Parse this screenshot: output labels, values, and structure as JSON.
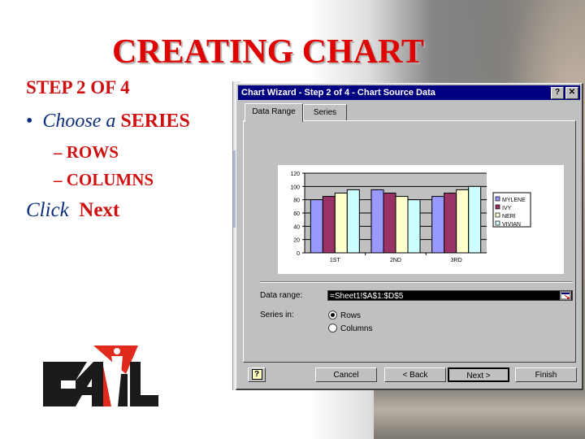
{
  "slide": {
    "title": "CREATING CHART",
    "step": "STEP 2 OF 4",
    "bullet": {
      "marker": "•",
      "prefix": "Choose a ",
      "emphasis": "SERIES"
    },
    "subitems": [
      "– ROWS",
      "– COLUMNS"
    ],
    "instruction": {
      "prefix": "Click",
      "action": "Next"
    },
    "logo_text": "CAIL",
    "colors": {
      "title": "#e00000",
      "body_blue": "#0c2f7c",
      "body_red": "#d01010"
    }
  },
  "dialog": {
    "title": "Chart Wizard - Step 2 of 4 - Chart Source Data",
    "help_glyph": "?",
    "close_glyph": "✕",
    "tabs": [
      {
        "label": "Data Range",
        "active": true
      },
      {
        "label": "Series",
        "active": false
      }
    ],
    "data_range_label": "Data range:",
    "data_range_value": "=Sheet1!$A$1:$D$5",
    "series_in_label": "Series in:",
    "series_options": [
      {
        "label": "Rows",
        "selected": true
      },
      {
        "label": "Columns",
        "selected": false
      }
    ],
    "buttons": {
      "help": "?",
      "cancel": "Cancel",
      "back": "< Back",
      "next": "Next >",
      "finish": "Finish"
    }
  },
  "chart_data": {
    "type": "bar",
    "categories": [
      "1ST",
      "2ND",
      "3RD"
    ],
    "series": [
      {
        "name": "MYLENE",
        "values": [
          80,
          95,
          85
        ],
        "color": "#9999ff"
      },
      {
        "name": "IVY",
        "values": [
          85,
          90,
          90
        ],
        "color": "#993366"
      },
      {
        "name": "NERI",
        "values": [
          90,
          85,
          95
        ],
        "color": "#ffffcc"
      },
      {
        "name": "VIVIAN",
        "values": [
          95,
          80,
          100
        ],
        "color": "#ccffff"
      }
    ],
    "yticks": [
      0,
      20,
      40,
      60,
      80,
      100,
      120
    ],
    "ylim": [
      0,
      120
    ],
    "title": "",
    "xlabel": "",
    "ylabel": "",
    "grid": true,
    "legend": "right",
    "plot_bg": "#c0c0c0"
  }
}
